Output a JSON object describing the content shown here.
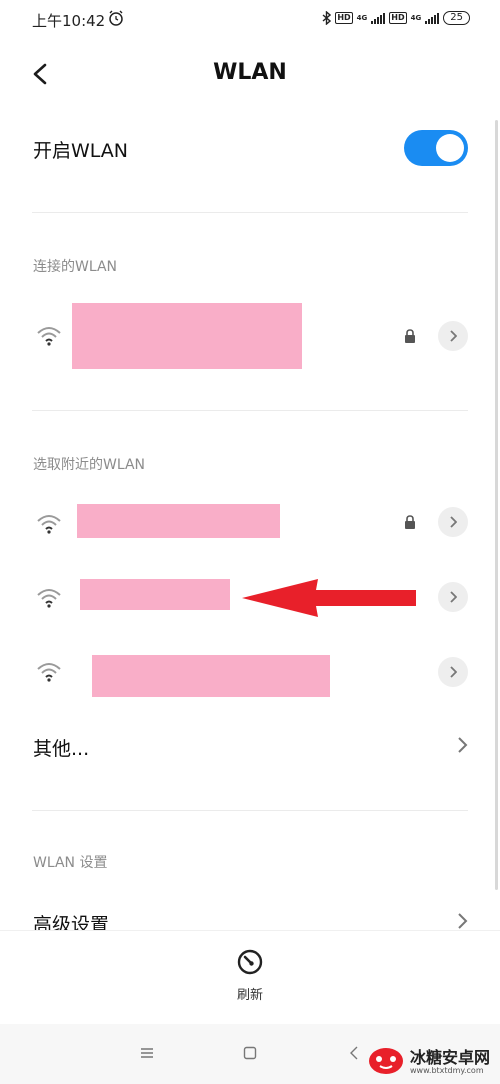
{
  "status_bar": {
    "time": "上午10:42",
    "net1": "4G",
    "net2": "4G",
    "hd": "HD",
    "battery": "25"
  },
  "header": {
    "title": "WLAN"
  },
  "toggle": {
    "label": "开启WLAN",
    "on": true,
    "color": "#1a8cf2"
  },
  "connected": {
    "section_title": "连接的WLAN",
    "networks": [
      {
        "name": "",
        "secured": true
      }
    ]
  },
  "nearby": {
    "section_title": "选取附近的WLAN",
    "networks": [
      {
        "name": "",
        "secured": true
      },
      {
        "name": "",
        "secured": true
      },
      {
        "name": "",
        "secured": false
      }
    ],
    "other_label": "其他..."
  },
  "settings": {
    "section_title": "WLAN 设置",
    "advanced_label": "高级设置"
  },
  "bottom": {
    "refresh_label": "刷新"
  },
  "watermark": {
    "name": "冰糖安卓网",
    "url": "www.btxtdmy.com"
  },
  "colors": {
    "accent": "#1a8cf2",
    "redaction": "#f9aec8",
    "arrow": "#e8202a"
  }
}
